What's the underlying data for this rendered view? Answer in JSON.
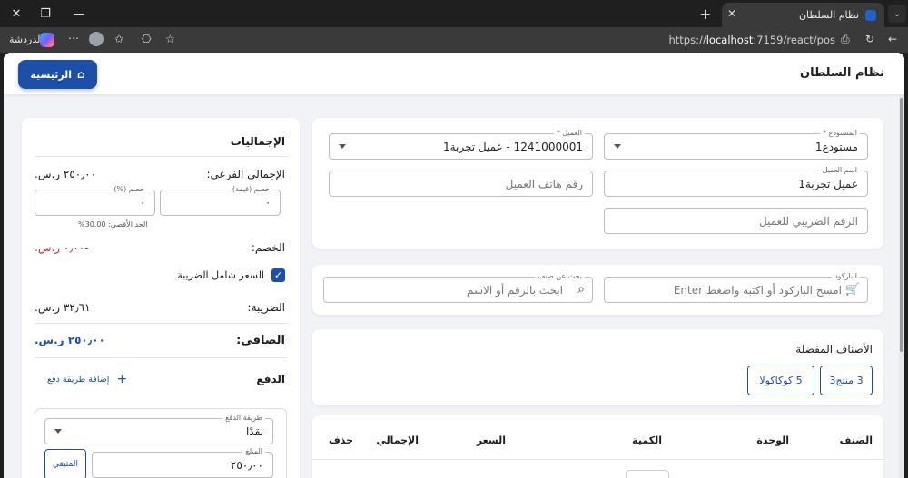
{
  "browser": {
    "tab_title": "نظام السلطان",
    "url_prefix": "https://",
    "url_host": "localhost",
    "url_rest": ":7159/react/pos",
    "chat_label": "الدردشة"
  },
  "header": {
    "title": "نظام السلطان",
    "home_label": "الرئيسية"
  },
  "customer": {
    "warehouse_label": "المستودع *",
    "warehouse_value": "مستودع1",
    "client_label": "العميل *",
    "client_value": "1241000001 - عميل تجربة1",
    "client_name_label": "اسم العميل",
    "client_name_value": "عميل تجربة1",
    "phone_placeholder": "رقم هاتف العميل",
    "tax_placeholder": "الرقم الضريبي للعميل"
  },
  "search": {
    "barcode_label": "الباركود",
    "barcode_placeholder": "امسح الباركود أو اكتبه واضغط Enter",
    "item_label": "بحث عن صنف",
    "item_placeholder": "ابحث بالرقم أو الاسم"
  },
  "favorites": {
    "title": "الأصناف المفضلة",
    "items": [
      {
        "label": "3 منتج3"
      },
      {
        "label": "5 كوكاكولا"
      }
    ]
  },
  "table": {
    "columns": [
      "الصنف",
      "الوحدة",
      "الكمية",
      "السعر",
      "الإجمالي",
      "حذف"
    ]
  },
  "totals": {
    "title": "الإجماليات",
    "subtotal_label": "الإجمالي الفرعي:",
    "subtotal_value": "٢٥٠٫٠٠ ر.س.",
    "discount_value_label": "خصم (قيمة)",
    "discount_value": "٠",
    "discount_pct_label": "خصم (%)",
    "discount_pct": "٠",
    "max_label": "الحد الأقصى: 30.00%",
    "discount_label": "الخصم:",
    "discount_amount": "-٠٫٠٠ ر.س.",
    "tax_inclusive_label": "السعر شامل الضريبة",
    "tax_label": "الضريبة:",
    "tax_value": "٣٢٫٦١ ر.س.",
    "net_label": "الصافي:",
    "net_value": "٢٥٠٫٠٠ ر.س.",
    "payment_label": "الدفع",
    "add_payment_label": "إضافة طريقة دفع",
    "method_label": "طريقة الدفع",
    "method_value": "نقدًا",
    "amount_label": "المبلغ",
    "amount_value": "٢٥٠٫٠٠",
    "remaining_label": "المتبقي"
  },
  "colors": {
    "primary": "#1d4ea8",
    "danger": "#c62828"
  }
}
